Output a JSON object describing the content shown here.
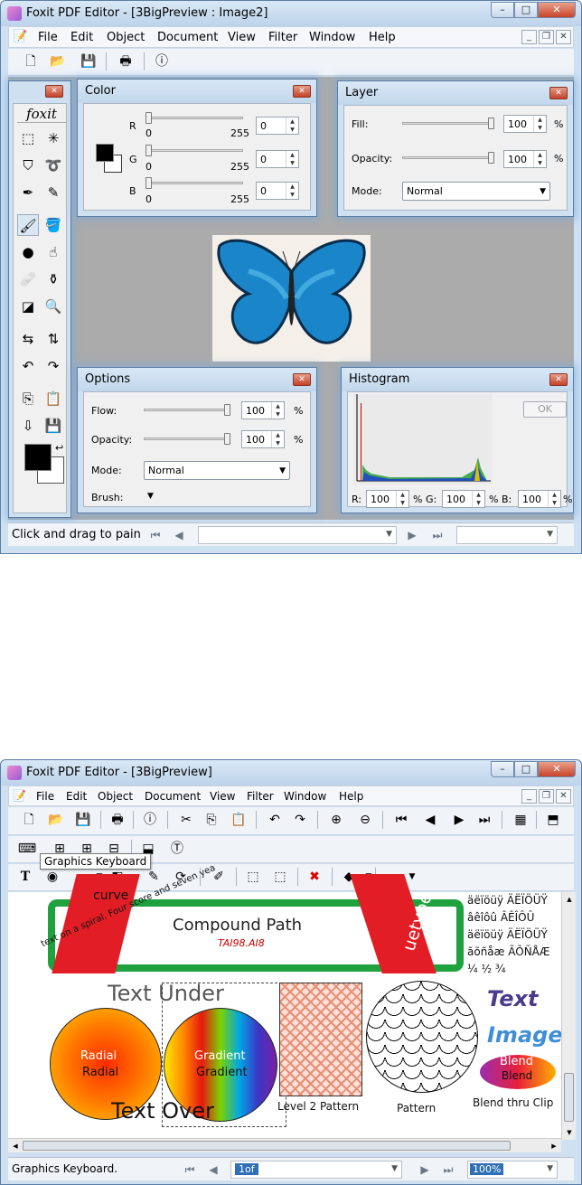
{
  "window1": {
    "title": "Foxit PDF Editor - [3BigPreview : Image2]",
    "menu": [
      "File",
      "Edit",
      "Object",
      "Document",
      "View",
      "Filter",
      "Window",
      "Help"
    ],
    "palette_logo": "foxit",
    "color_panel": {
      "title": "Color",
      "r_label": "R",
      "g_label": "G",
      "b_label": "B",
      "min": "0",
      "max": "255",
      "r": "0",
      "g": "0",
      "b": "0"
    },
    "layer_panel": {
      "title": "Layer",
      "fill_label": "Fill:",
      "fill": "100",
      "opacity_label": "Opacity:",
      "opacity": "100",
      "pct": "%",
      "mode_label": "Mode:",
      "mode": "Normal"
    },
    "options_panel": {
      "title": "Options",
      "flow_label": "Flow:",
      "flow": "100",
      "opacity_label": "Opacity:",
      "opacity": "100",
      "pct": "%",
      "mode_label": "Mode:",
      "mode": "Normal",
      "brush_label": "Brush:"
    },
    "histogram_panel": {
      "title": "Histogram",
      "ok": "OK",
      "r_label": "R:",
      "r": "100",
      "g_label": "G:",
      "g": "100",
      "b_label": "B:",
      "b": "100",
      "pct": "%"
    },
    "status": "Click and drag to pain"
  },
  "window2": {
    "title": "Foxit PDF Editor - [3BigPreview]",
    "menu": [
      "File",
      "Edit",
      "Object",
      "Document",
      "View",
      "Filter",
      "Window",
      "Help"
    ],
    "tooltip": "Graphics Keyboard",
    "canvas": {
      "compound_path": "Compound Path",
      "compound_file": "TAI98.AI8",
      "curve": "curve",
      "spiral_text": "text on a spiral. Four score and seven years ago our fathers brought",
      "truetype": "uetype",
      "chars1": "äëïöüÿ ÄËÏÖÜŸ",
      "chars2": "âêîôû ÂÊÎÔÛ",
      "chars3": "äëïöüÿ ÄËÏÖÜŸ",
      "chars4": "ãõñåæ ÃÕÑÅÆ",
      "chars5": "¼ ½ ¾",
      "text_under": "Text Under",
      "text_over": "Text Over",
      "radial_white": "Radial",
      "radial_black": "Radial",
      "gradient_white": "Gradient",
      "gradient_black": "Gradient",
      "level2": "Level 2 Pattern",
      "pattern": "Pattern",
      "text_word": "Text",
      "image_word": "Image",
      "blend_white": "Blend",
      "blend_black": "Blend",
      "blend_clip": "Blend thru Clip"
    },
    "status": "Graphics Keyboard.",
    "page_field": "1of",
    "zoom": "100%"
  },
  "colors": {
    "accent": "#2f6fb5",
    "green_frame": "#1fa23e",
    "red_band": "#e21d25",
    "titlebar": "#c5d9ef"
  }
}
